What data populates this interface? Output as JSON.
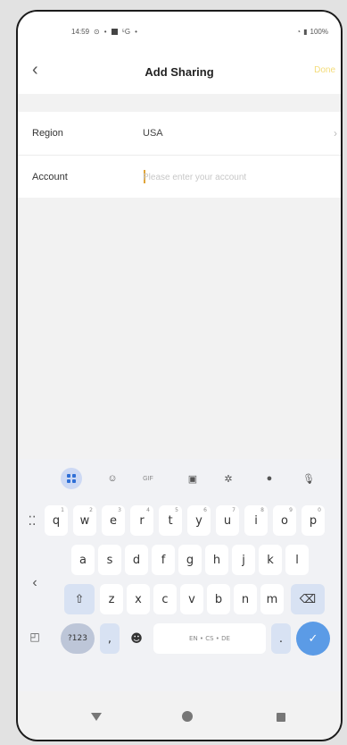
{
  "status_bar": {
    "time": "14:59",
    "network": "⁵G",
    "battery": "100%"
  },
  "header": {
    "title": "Add Sharing",
    "done_label": "Done"
  },
  "form": {
    "region_label": "Region",
    "region_value": "USA",
    "account_label": "Account",
    "account_placeholder": "Please enter your account",
    "account_value": ""
  },
  "keyboard": {
    "gif_label": "GIF",
    "row1": [
      "q",
      "w",
      "e",
      "r",
      "t",
      "y",
      "u",
      "i",
      "o",
      "p"
    ],
    "row1_alt": [
      "1",
      "2",
      "3",
      "4",
      "5",
      "6",
      "7",
      "8",
      "9",
      "0"
    ],
    "row2": [
      "a",
      "s",
      "d",
      "f",
      "g",
      "h",
      "j",
      "k",
      "l"
    ],
    "row3": [
      "z",
      "x",
      "c",
      "v",
      "b",
      "n",
      "m"
    ],
    "symbols_label": "?123",
    "comma_label": ",",
    "space_label": "EN • CS • DE",
    "period_label": ".",
    "enter_icon": "checkmark-icon"
  }
}
